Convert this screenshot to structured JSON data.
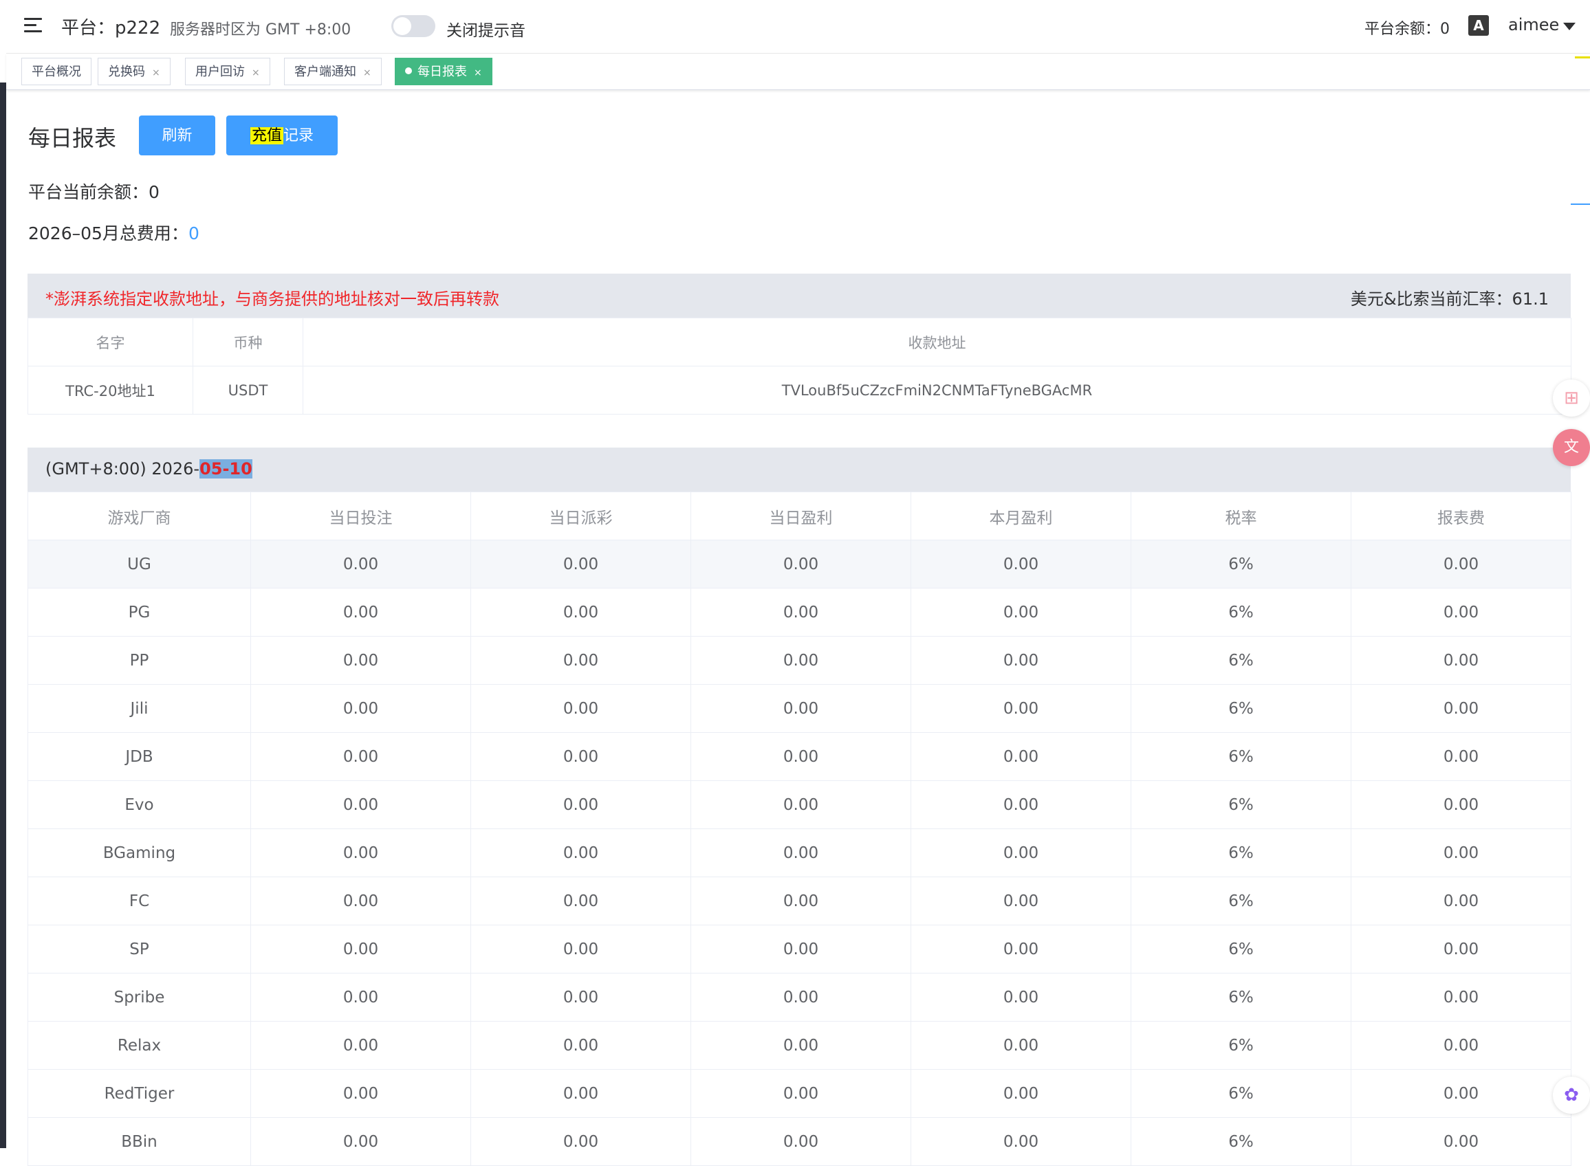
{
  "header": {
    "platform": "平台：p222",
    "timezone": "服务器时区为 GMT +8:00",
    "mute_label": "关闭提示音",
    "balance": "平台余额：0",
    "lang_icon": "A",
    "user": "aimee"
  },
  "tags": [
    {
      "label": "平台概况",
      "closable": false
    },
    {
      "label": "兑换码",
      "closable": true
    },
    {
      "label": "用户回访",
      "closable": true
    },
    {
      "label": "客户端通知",
      "closable": true
    },
    {
      "label": "每日报表",
      "closable": true,
      "active": true
    }
  ],
  "close_glyph": "×",
  "page": {
    "title": "每日报表",
    "refresh": "刷新",
    "recharge_hl": "充值",
    "recharge_rest": "记录",
    "current_balance": "平台当前余额：0",
    "monthly_label": "2026–05月总费用：",
    "monthly_value": "0"
  },
  "address": {
    "notice": "*澎湃系统指定收款地址，与商务提供的地址核对一致后再转款",
    "rate": "美元&比索当前汇率：61.1",
    "headers": [
      "名字",
      "币种",
      "收款地址"
    ],
    "rows": [
      [
        "TRC-20地址1",
        "USDT",
        "TVLouBf5uCZzcFmiN2CNMTaFTyneBGAcMR"
      ]
    ]
  },
  "report": {
    "date_prefix": "(GMT+8:00) 2026-",
    "date_sel": "05-10",
    "headers": [
      "游戏厂商",
      "当日投注",
      "当日派彩",
      "当日盈利",
      "本月盈利",
      "税率",
      "报表费"
    ],
    "rows": [
      [
        "UG",
        "0.00",
        "0.00",
        "0.00",
        "0.00",
        "6%",
        "0.00"
      ],
      [
        "PG",
        "0.00",
        "0.00",
        "0.00",
        "0.00",
        "6%",
        "0.00"
      ],
      [
        "PP",
        "0.00",
        "0.00",
        "0.00",
        "0.00",
        "6%",
        "0.00"
      ],
      [
        "Jili",
        "0.00",
        "0.00",
        "0.00",
        "0.00",
        "6%",
        "0.00"
      ],
      [
        "JDB",
        "0.00",
        "0.00",
        "0.00",
        "0.00",
        "6%",
        "0.00"
      ],
      [
        "Evo",
        "0.00",
        "0.00",
        "0.00",
        "0.00",
        "6%",
        "0.00"
      ],
      [
        "BGaming",
        "0.00",
        "0.00",
        "0.00",
        "0.00",
        "6%",
        "0.00"
      ],
      [
        "FC",
        "0.00",
        "0.00",
        "0.00",
        "0.00",
        "6%",
        "0.00"
      ],
      [
        "SP",
        "0.00",
        "0.00",
        "0.00",
        "0.00",
        "6%",
        "0.00"
      ],
      [
        "Spribe",
        "0.00",
        "0.00",
        "0.00",
        "0.00",
        "6%",
        "0.00"
      ],
      [
        "Relax",
        "0.00",
        "0.00",
        "0.00",
        "0.00",
        "6%",
        "0.00"
      ],
      [
        "RedTiger",
        "0.00",
        "0.00",
        "0.00",
        "0.00",
        "6%",
        "0.00"
      ],
      [
        "BBin",
        "0.00",
        "0.00",
        "0.00",
        "0.00",
        "6%",
        "0.00"
      ]
    ]
  },
  "icons": {
    "menu": "menu-icon",
    "translate": "translate-icon",
    "widgets": "grid-plus-icon",
    "translate_float": "translate-float-icon",
    "assistant": "brain-icon"
  },
  "colors": {
    "primary": "#409eff",
    "active_tag": "#42b983",
    "notice": "#f0262a"
  }
}
